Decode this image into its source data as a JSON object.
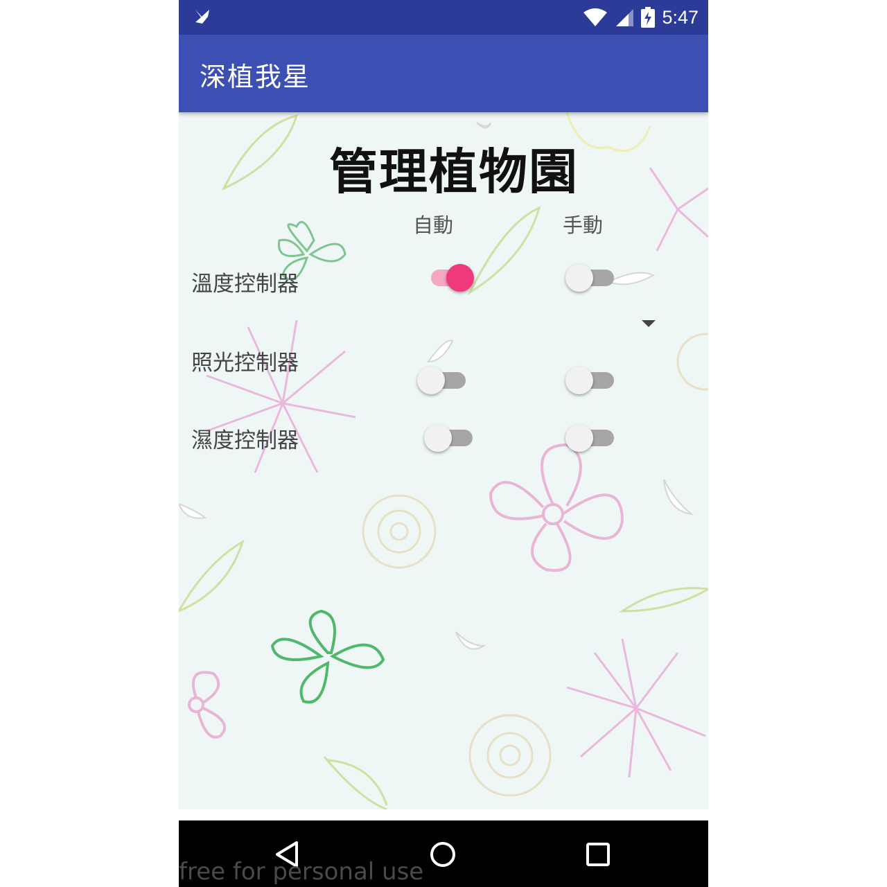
{
  "status_bar": {
    "time": "5:47",
    "icons": [
      "app-notification-icon",
      "wifi-icon",
      "signal-icon",
      "battery-charging-icon"
    ]
  },
  "app_bar": {
    "title": "深植我星"
  },
  "main": {
    "heading": "管理植物園",
    "columns": {
      "auto": "自動",
      "manual": "手動"
    },
    "rows": [
      {
        "label": "溫度控制器",
        "auto_on": true,
        "manual_on": false
      },
      {
        "label": "照光控制器",
        "auto_on": false,
        "manual_on": false
      },
      {
        "label": "濕度控制器",
        "auto_on": false,
        "manual_on": false
      }
    ]
  },
  "nav_bar": {
    "icons": [
      "back-icon",
      "home-icon",
      "recents-icon"
    ]
  },
  "watermark": "free for personal use",
  "colors": {
    "status_bar": "#2b3b97",
    "app_bar": "#3c50b4",
    "accent": "#f0397b",
    "switch_off_track": "#a6a6a6"
  }
}
